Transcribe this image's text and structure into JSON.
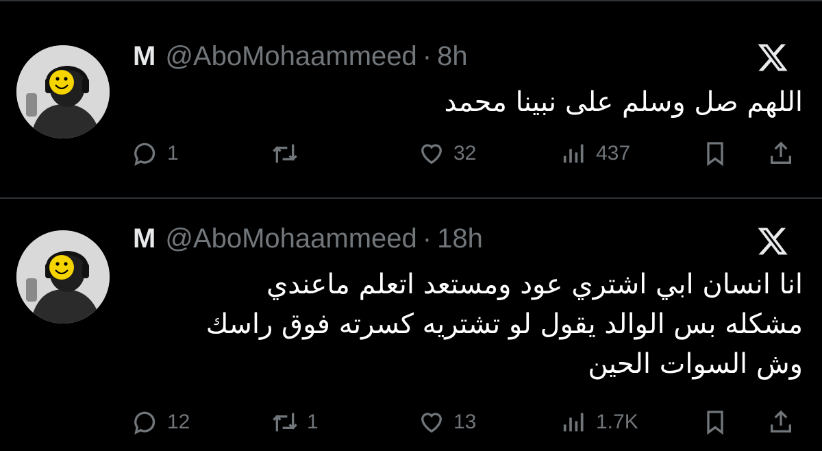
{
  "tweets": [
    {
      "name": "M",
      "handle": "@AboMohaammeed",
      "separator": "·",
      "time": "8h",
      "lines": [
        "اللهم صل وسلم على نبينا محمد"
      ],
      "replies": "1",
      "retweets": "",
      "likes": "32",
      "views": "437"
    },
    {
      "name": "M",
      "handle": "@AboMohaammeed",
      "separator": "·",
      "time": "18h",
      "lines": [
        "انا انسان ابي اشتري عود ومستعد اتعلم ماعندي",
        "مشكله بس الوالد يقول لو تشتريه كسرته فوق راسك",
        "وش السوات الحين"
      ],
      "replies": "12",
      "retweets": "1",
      "likes": "13",
      "views": "1.7K"
    }
  ],
  "icons": {
    "brand": "x-logo-icon",
    "reply": "reply-icon",
    "retweet": "retweet-icon",
    "like": "heart-icon",
    "views": "views-icon",
    "bookmark": "bookmark-icon",
    "share": "share-icon"
  },
  "colors": {
    "background": "#000000",
    "text": "#e7e9ea",
    "muted": "#71767b",
    "divider": "#2f3336",
    "emoji": "#f6d400"
  }
}
